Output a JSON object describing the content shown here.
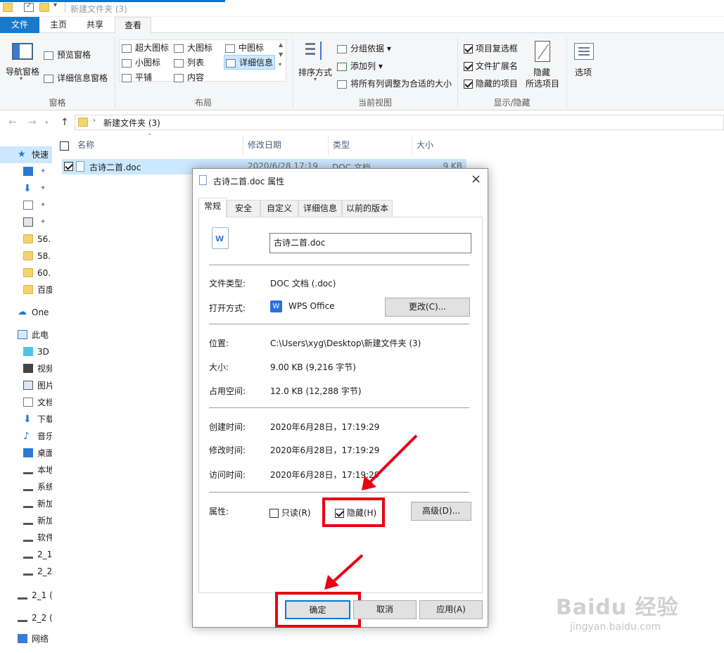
{
  "window": {
    "title": "新建文件夹 (3)"
  },
  "ribbon": {
    "tabs": [
      {
        "label": "文件"
      },
      {
        "label": "主页"
      },
      {
        "label": "共享"
      },
      {
        "label": "查看"
      }
    ],
    "panes": {
      "nav_pane": "导航窗格",
      "preview_pane": "预览窗格",
      "details_pane": "详细信息窗格",
      "group": "窗格"
    },
    "layout": {
      "extra_large": "超大图标",
      "large": "大图标",
      "medium": "中图标",
      "small": "小图标",
      "list": "列表",
      "details": "详细信息",
      "tiles": "平铺",
      "content": "内容",
      "group": "布局"
    },
    "current_view": {
      "sort": "排序方式",
      "group_by": "分组依据",
      "add_column": "添加列",
      "fit_columns": "将所有列调整为合适的大小",
      "group": "当前视图"
    },
    "show_hide": {
      "item_checkboxes": "项目复选框",
      "file_extensions": "文件扩展名",
      "hidden_items": "隐藏的项目",
      "hide_selected_1": "隐藏",
      "hide_selected_2": "所选项目",
      "options": "选项",
      "group": "显示/隐藏"
    }
  },
  "address": {
    "path": "新建文件夹 (3)"
  },
  "nav": {
    "quick_access": "快速",
    "items": [
      "56.",
      "58.",
      "60.",
      "百度"
    ],
    "onedrive": "One",
    "this_pc": "此电",
    "pc_items": [
      "3D",
      "视频",
      "图片",
      "文档",
      "下载",
      "音乐",
      "桌面",
      "本地",
      "系统",
      "新加",
      "新加",
      "软件",
      "2_1",
      "2_2"
    ],
    "drives": [
      "2_1 (",
      "2_2 ("
    ],
    "network": "网络"
  },
  "files": {
    "headers": {
      "name": "名称",
      "modified": "修改日期",
      "type": "类型",
      "size": "大小"
    },
    "rows": [
      {
        "name": "古诗二首.doc",
        "modified": "2020/6/28 17:19",
        "type": "DOC 文档",
        "size": "9 KB"
      }
    ]
  },
  "dialog": {
    "title": "古诗二首.doc 属性",
    "tabs": [
      "常规",
      "安全",
      "自定义",
      "详细信息",
      "以前的版本"
    ],
    "filename": "古诗二首.doc",
    "file_type_label": "文件类型:",
    "file_type": "DOC 文档 (.doc)",
    "open_with_label": "打开方式:",
    "open_with": "WPS Office",
    "change_button": "更改(C)...",
    "location_label": "位置:",
    "location": "C:\\Users\\xyg\\Desktop\\新建文件夹 (3)",
    "size_label": "大小:",
    "size": "9.00 KB (9,216 字节)",
    "disk_size_label": "占用空间:",
    "disk_size": "12.0 KB (12,288 字节)",
    "created_label": "创建时间:",
    "created": "2020年6月28日，17:19:29",
    "modified_label": "修改时间:",
    "modified": "2020年6月28日，17:19:29",
    "accessed_label": "访问时间:",
    "accessed": "2020年6月28日，17:19:29",
    "attributes_label": "属性:",
    "readonly": "只读(R)",
    "hidden": "隐藏(H)",
    "advanced_button": "高级(D)...",
    "ok_button": "确定",
    "cancel_button": "取消",
    "apply_button": "应用(A)"
  },
  "watermark": {
    "brand": "Baidu 经验",
    "url": "jingyan.baidu.com"
  },
  "colors": {
    "accent": "#0078d7",
    "file_tab": "#1979ca",
    "highlight": "#e60012",
    "selection": "#cce8ff"
  }
}
